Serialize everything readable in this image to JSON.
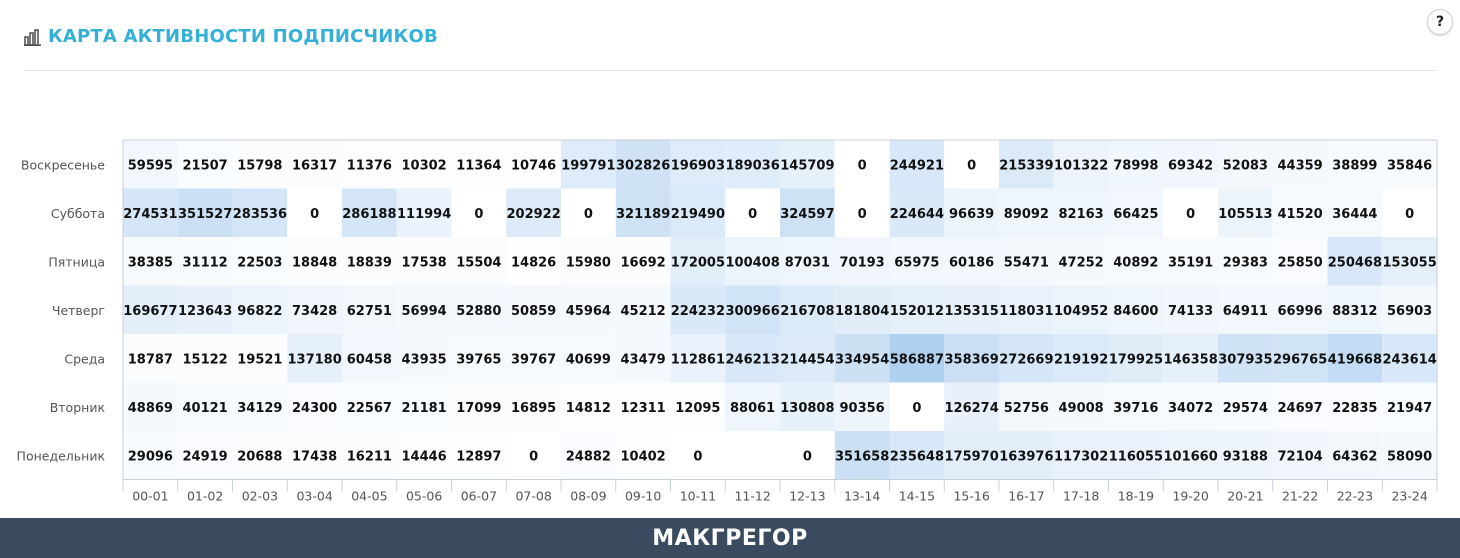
{
  "header": {
    "title": "КАРТА АКТИВНОСТИ ПОДПИСЧИКОВ",
    "help_label": "?",
    "icon": "bar-chart-icon"
  },
  "footer": {
    "brand": "МАКГРЕГОР"
  },
  "colors": {
    "title": "#35b1d8",
    "footer_bg": "#3a4b5f",
    "cell_low": "#ffffff",
    "cell_high": "#b6d3f0"
  },
  "chart_data": {
    "type": "heatmap",
    "title": "КАРТА АКТИВНОСТИ ПОДПИСЧИКОВ",
    "x_labels": [
      "00-01",
      "01-02",
      "02-03",
      "03-04",
      "04-05",
      "05-06",
      "06-07",
      "07-08",
      "08-09",
      "09-10",
      "10-11",
      "11-12",
      "12-13",
      "13-14",
      "14-15",
      "15-16",
      "16-17",
      "17-18",
      "18-19",
      "19-20",
      "20-21",
      "21-22",
      "22-23",
      "23-24"
    ],
    "y_labels": [
      "Воскресенье",
      "Суббота",
      "Пятница",
      "Четверг",
      "Среда",
      "Вторник",
      "Понедельник"
    ],
    "values": [
      [
        59595,
        21507,
        15798,
        16317,
        11376,
        10302,
        11364,
        10746,
        199791,
        302826,
        196903,
        189036,
        145709,
        0,
        244921,
        0,
        215339,
        101322,
        78998,
        69342,
        52083,
        44359,
        38899,
        35846
      ],
      [
        274531,
        351527,
        283536,
        0,
        286188,
        111994,
        0,
        202922,
        0,
        321189,
        219490,
        0,
        324597,
        0,
        224644,
        96639,
        89092,
        82163,
        66425,
        0,
        105513,
        41520,
        36444,
        0
      ],
      [
        38385,
        31112,
        22503,
        18848,
        18839,
        17538,
        15504,
        14826,
        15980,
        16692,
        172005,
        100408,
        87031,
        70193,
        65975,
        60186,
        55471,
        47252,
        40892,
        35191,
        29383,
        25850,
        250468,
        153055
      ],
      [
        169677,
        123643,
        96822,
        73428,
        62751,
        56994,
        52880,
        50859,
        45964,
        45212,
        224232,
        300966,
        216708,
        181804,
        152012,
        135315,
        118031,
        104952,
        84600,
        74133,
        64911,
        66996,
        88312,
        56903
      ],
      [
        18787,
        15122,
        19521,
        137180,
        60458,
        43935,
        39765,
        39767,
        40699,
        43479,
        112861,
        246213,
        214454,
        334954,
        586887,
        358369,
        272669,
        219192,
        179925,
        146358,
        307935,
        296765,
        419668,
        243614
      ],
      [
        48869,
        40121,
        34129,
        24300,
        22567,
        21181,
        17099,
        16895,
        14812,
        12311,
        12095,
        88061,
        130808,
        90356,
        0,
        126274,
        52756,
        49008,
        39716,
        34072,
        29574,
        24697,
        22835,
        21947
      ],
      [
        29096,
        24919,
        20688,
        17438,
        16211,
        14446,
        12897,
        0,
        24882,
        10402,
        0,
        null,
        0,
        351658,
        235648,
        175970,
        163976,
        117302,
        116055,
        101660,
        93188,
        72104,
        64362,
        58090
      ]
    ]
  }
}
